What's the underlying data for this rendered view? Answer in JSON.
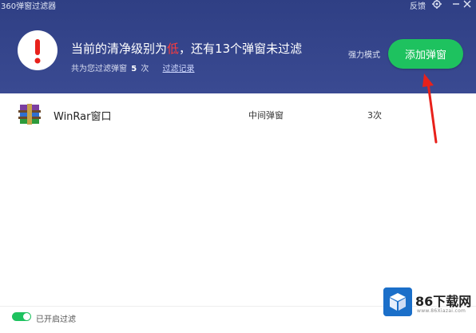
{
  "window": {
    "title": "360弹窗过滤器",
    "feedback_label": "反馈"
  },
  "header": {
    "headline_prefix": "当前的清净级别为",
    "level": "低",
    "headline_suffix": "，还有13个弹窗未过滤",
    "filtered_prefix": "共为您过滤弹窗",
    "filtered_count": "5",
    "filtered_suffix": "次",
    "filter_record_link": "过滤记录",
    "mode_label": "强力模式",
    "add_button_label": "添加弹窗"
  },
  "popups": [
    {
      "name": "WinRar窗口",
      "type": "中间弹窗",
      "count": "3次",
      "icon": "winrar-icon"
    }
  ],
  "footer": {
    "toggle_label": "已开启过滤",
    "toggle_on": true
  },
  "watermark": {
    "text": "86下载网",
    "url": "www.86Xiazai.com"
  },
  "colors": {
    "header_bg": "#34448a",
    "accent_green": "#1ec25f",
    "level_red": "#ff3b3b",
    "arrow_red": "#e8211b"
  }
}
